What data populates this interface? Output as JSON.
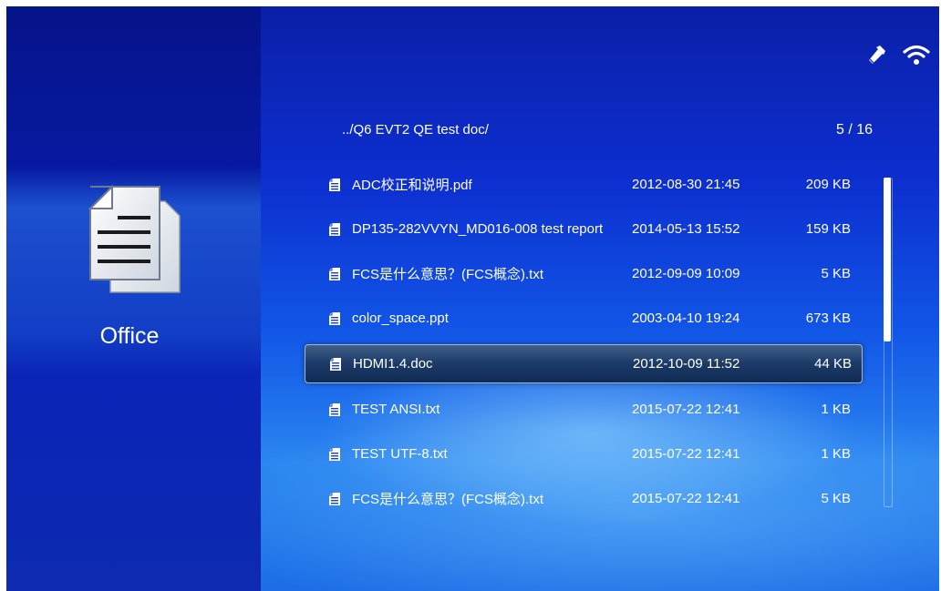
{
  "sidebar": {
    "category_label": "Office",
    "category_icon": "document-icon"
  },
  "status_bar": {
    "icons": [
      "usb-stick-icon",
      "wifi-icon"
    ]
  },
  "browser": {
    "path": "../Q6 EVT2 QE test doc/",
    "page_indicator": "5 / 16",
    "selected_index": 4,
    "files": [
      {
        "name": "ADC校正和说明.pdf",
        "date": "2012-08-30 21:45",
        "size": "209 KB"
      },
      {
        "name": "DP135-282VVYN_MD016-008  test report",
        "date": "2014-05-13 15:52",
        "size": "159 KB"
      },
      {
        "name": "FCS是什么意思？(FCS概念).txt",
        "date": "2012-09-09 10:09",
        "size": "5 KB"
      },
      {
        "name": "color_space.ppt",
        "date": "2003-04-10 19:24",
        "size": "673 KB"
      },
      {
        "name": "HDMI1.4.doc",
        "date": "2012-10-09 11:52",
        "size": "44 KB"
      },
      {
        "name": "TEST ANSI.txt",
        "date": "2015-07-22 12:41",
        "size": "1 KB"
      },
      {
        "name": "TEST UTF-8.txt",
        "date": "2015-07-22 12:41",
        "size": "1 KB"
      },
      {
        "name": "FCS是什么意思？(FCS概念).txt",
        "date": "2015-07-22 12:41",
        "size": "5 KB"
      }
    ]
  },
  "colors": {
    "background_top": "#0a1fa8",
    "background_bottom": "#2b86f0",
    "selection": "#1b3a66",
    "text": "#ffffff"
  }
}
